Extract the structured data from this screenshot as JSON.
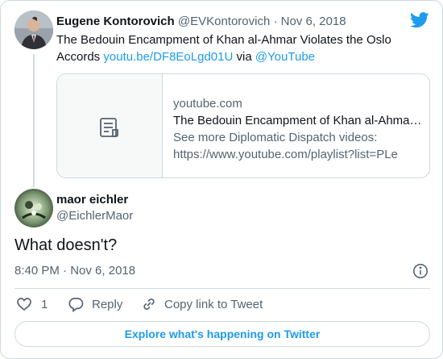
{
  "quoted_tweet": {
    "author_name": "Eugene Kontorovich",
    "author_handle": "@EVKontorovich",
    "separator": " · ",
    "date": "Nov 6, 2018",
    "text_line1": "The Bedouin Encampment of Khan al-Ahmar Violates the Oslo",
    "text_prefix": "Accords ",
    "link_text": "youtu.be/DF8EoLgd01U",
    "via_text": " via ",
    "via_handle": "@YouTube"
  },
  "link_preview": {
    "domain": "youtube.com",
    "title": "The Bedouin Encampment of Khan al-Ahmar Violates the Oslo Accords",
    "description_line1": "See more Diplomatic Dispatch videos:",
    "description_line2": "https://www.youtube.com/playlist?list=PLe"
  },
  "reply_tweet": {
    "author_name": "maor eichler",
    "author_handle": "@EichlerMaor",
    "text": "What doesn't?",
    "time": "8:40 PM",
    "separator": " · ",
    "date": "Nov 6, 2018"
  },
  "actions": {
    "like_count": "1",
    "reply_label": "Reply",
    "copy_link_label": "Copy link to Tweet"
  },
  "footer": {
    "explore_label": "Explore what's happening on Twitter"
  },
  "colors": {
    "twitter_blue": "#1d9bf0",
    "text": "#0f1419",
    "muted": "#536471",
    "border": "#cfd9de"
  },
  "icons": [
    "twitter-bird-icon",
    "document-icon",
    "info-icon",
    "heart-icon",
    "reply-bubble-icon",
    "link-icon"
  ]
}
